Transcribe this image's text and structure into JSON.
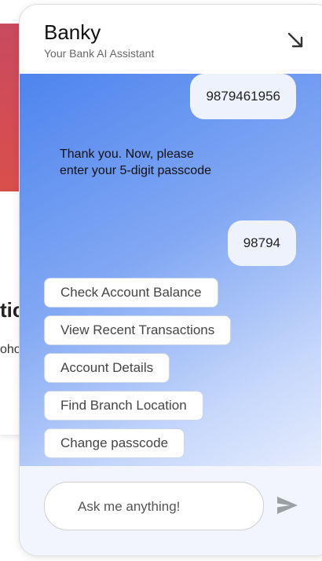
{
  "background_page": {
    "heading_fragment": "tic",
    "text_fragment": "oho"
  },
  "header": {
    "title": "Banky",
    "subtitle": "Your Bank AI Assistant",
    "minimize_icon": "arrow-down-right-icon"
  },
  "messages": [
    {
      "from": "user",
      "text": "9879461956"
    },
    {
      "from": "bot",
      "text": "Thank you. Now, please enter your 5-digit passcode"
    },
    {
      "from": "user",
      "text": "98794"
    }
  ],
  "quick_replies": [
    "Check Account Balance",
    "View Recent Transactions",
    "Account Details",
    "Find Branch Location",
    "Change passcode"
  ],
  "input": {
    "placeholder": "Ask me anything!",
    "value": "",
    "send_icon": "send-icon"
  },
  "colors": {
    "accent": "#4d84ee",
    "user_bubble": "#eef2fc",
    "footer_bg": "#f2f5fd",
    "send_icon": "#9aa0a6"
  }
}
